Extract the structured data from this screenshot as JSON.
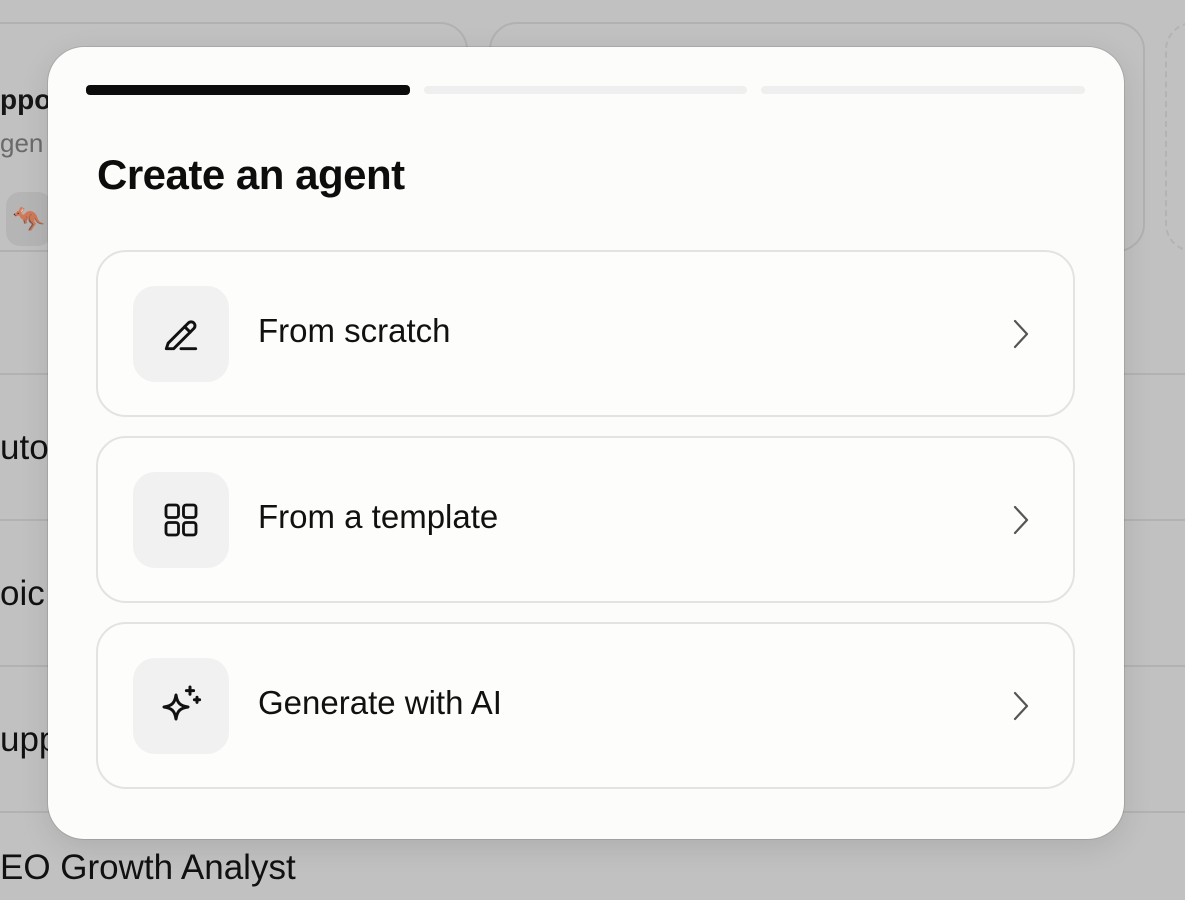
{
  "background": {
    "card_title": "ppo",
    "card_subtitle": "gen",
    "card_avatar_emoji": "🦘",
    "rows": [
      {
        "label": "uto"
      },
      {
        "label": "oic"
      },
      {
        "label": "upp"
      },
      {
        "label": "EO Growth Analyst"
      }
    ]
  },
  "modal": {
    "title": "Create an agent",
    "steps_total": 3,
    "step_current": 1,
    "options": [
      {
        "label": "From scratch",
        "icon": "pencil-icon"
      },
      {
        "label": "From a template",
        "icon": "grid-icon"
      },
      {
        "label": "Generate with AI",
        "icon": "sparkle-icon"
      }
    ]
  }
}
